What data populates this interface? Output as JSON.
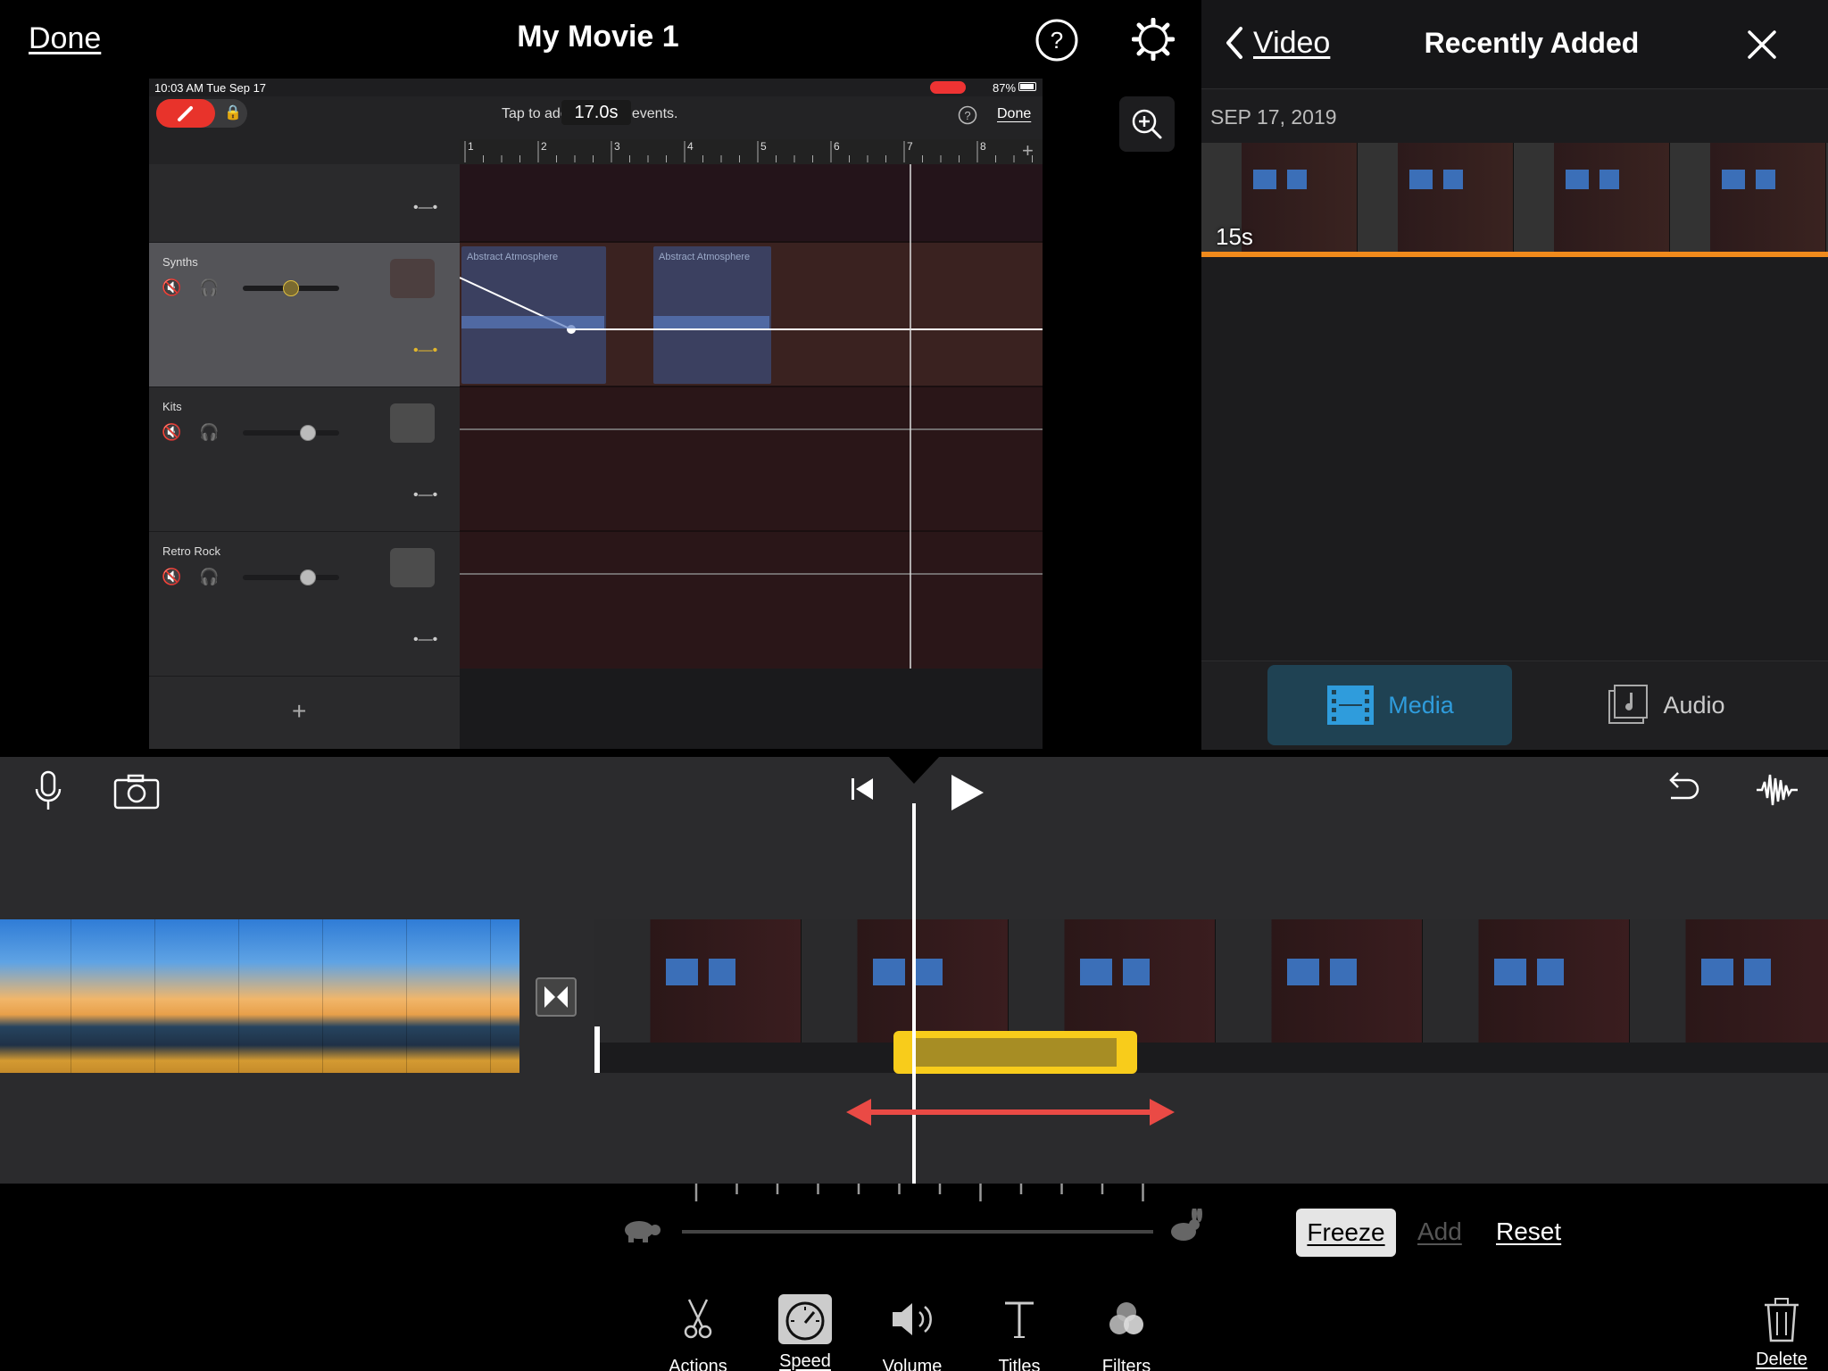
{
  "header": {
    "done_label": "Done",
    "project_title": "My Movie 1",
    "help_icon": "question-circle-icon",
    "settings_icon": "gear-icon",
    "zoom_icon": "zoom-in-icon"
  },
  "viewer": {
    "status_time": "10:03 AM  Tue Sep 17",
    "status_battery": "87%",
    "hint_text": "Tap to add or delete events.",
    "time_badge": "17.0s",
    "done_label": "Done",
    "ruler_labels": [
      "1",
      "2",
      "3",
      "4",
      "5",
      "6",
      "7",
      "8"
    ],
    "tracks": [
      {
        "name": "",
        "volume_level": 0
      },
      {
        "name": "Synths",
        "volume_level": 0.5
      },
      {
        "name": "Kits",
        "volume_level": 0.68
      },
      {
        "name": "Retro Rock",
        "volume_level": 0.68
      }
    ],
    "regions": [
      "Abstract Atmosphere",
      "Abstract Atmosphere"
    ]
  },
  "browser": {
    "back_label": "Video",
    "title": "Recently Added",
    "date_header": "SEP 17, 2019",
    "clip_duration": "15s",
    "tabs": [
      {
        "label": "Media",
        "icon": "film-icon",
        "selected": true
      },
      {
        "label": "Audio",
        "icon": "music-note-icon",
        "selected": false
      }
    ]
  },
  "timeline": {
    "left_icons": [
      "microphone-icon",
      "camera-icon"
    ],
    "center_icons": [
      "skip-to-start-icon",
      "play-icon"
    ],
    "right_icons": [
      "undo-icon",
      "waveform-icon"
    ]
  },
  "speed": {
    "freeze_label": "Freeze",
    "add_label": "Add",
    "reset_label": "Reset",
    "slow_icon": "tortoise-icon",
    "fast_icon": "hare-icon"
  },
  "toolbar": {
    "items": [
      {
        "label": "Actions",
        "icon": "scissors-icon",
        "selected": false
      },
      {
        "label": "Speed",
        "icon": "speedometer-icon",
        "selected": true
      },
      {
        "label": "Volume",
        "icon": "speaker-icon",
        "selected": false
      },
      {
        "label": "Titles",
        "icon": "text-t-icon",
        "selected": false
      },
      {
        "label": "Filters",
        "icon": "filters-icon",
        "selected": false
      }
    ],
    "delete_label": "Delete",
    "delete_icon": "trash-icon"
  },
  "colors": {
    "accent_yellow": "#f8cc1b",
    "accent_blue": "#2f9cdc",
    "arrow_red": "#ea4a45",
    "orange_bar": "#f08a1c"
  }
}
